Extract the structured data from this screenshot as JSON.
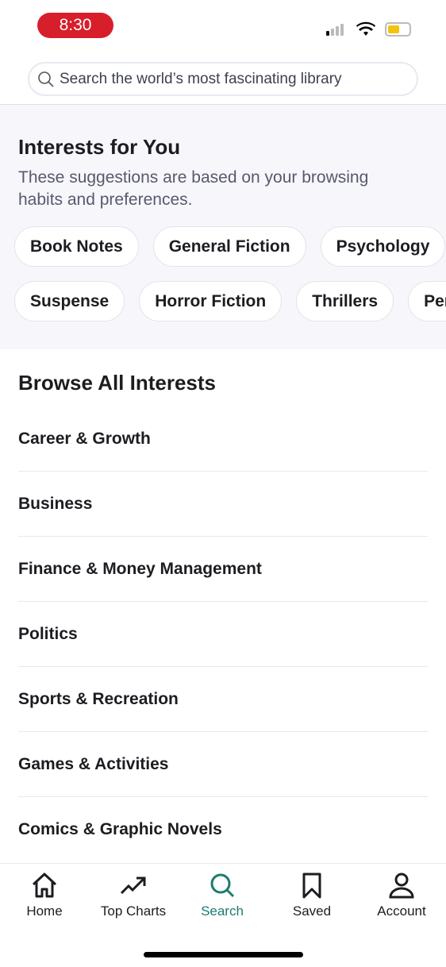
{
  "status_bar": {
    "time": "8:30"
  },
  "search": {
    "placeholder": "Search the world’s most fascinating library"
  },
  "interests": {
    "title": "Interests for You",
    "subtitle": "These suggestions are based on your browsing habits and preferences.",
    "row1": [
      "Book Notes",
      "General Fiction",
      "Psychology"
    ],
    "row2": [
      "Suspense",
      "Horror Fiction",
      "Thrillers",
      "Per"
    ]
  },
  "browse": {
    "title": "Browse All Interests",
    "items": [
      "Career & Growth",
      "Business",
      "Finance & Money Management",
      "Politics",
      "Sports & Recreation",
      "Games & Activities",
      "Comics & Graphic Novels"
    ]
  },
  "tabs": [
    {
      "label": "Home",
      "icon": "home-icon"
    },
    {
      "label": "Top Charts",
      "icon": "trending-icon"
    },
    {
      "label": "Search",
      "icon": "search-icon",
      "active": true
    },
    {
      "label": "Saved",
      "icon": "bookmark-icon"
    },
    {
      "label": "Account",
      "icon": "person-icon"
    }
  ],
  "colors": {
    "accent": "#1e7b6e",
    "time_pill": "#d71f2b",
    "section_bg": "#f6f6fb"
  }
}
